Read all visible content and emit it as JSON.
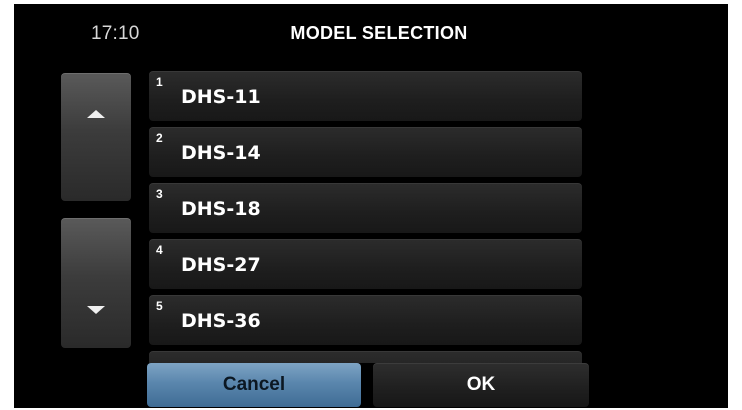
{
  "status": {
    "time": "17:10"
  },
  "header": {
    "title": "MODEL SELECTION"
  },
  "scroll": {
    "up_icon": "triangle-up-icon",
    "down_icon": "triangle-down-icon"
  },
  "models": [
    {
      "number": "1",
      "label": "DHS-11"
    },
    {
      "number": "2",
      "label": "DHS-14"
    },
    {
      "number": "3",
      "label": "DHS-18"
    },
    {
      "number": "4",
      "label": "DHS-27"
    },
    {
      "number": "5",
      "label": "DHS-36"
    },
    {
      "number": "",
      "label": ""
    }
  ],
  "actions": {
    "cancel_label": "Cancel",
    "ok_label": "OK"
  },
  "colors": {
    "background": "#000000",
    "cancel_accent": "#5a86ad",
    "row": "#1e1e1e"
  }
}
